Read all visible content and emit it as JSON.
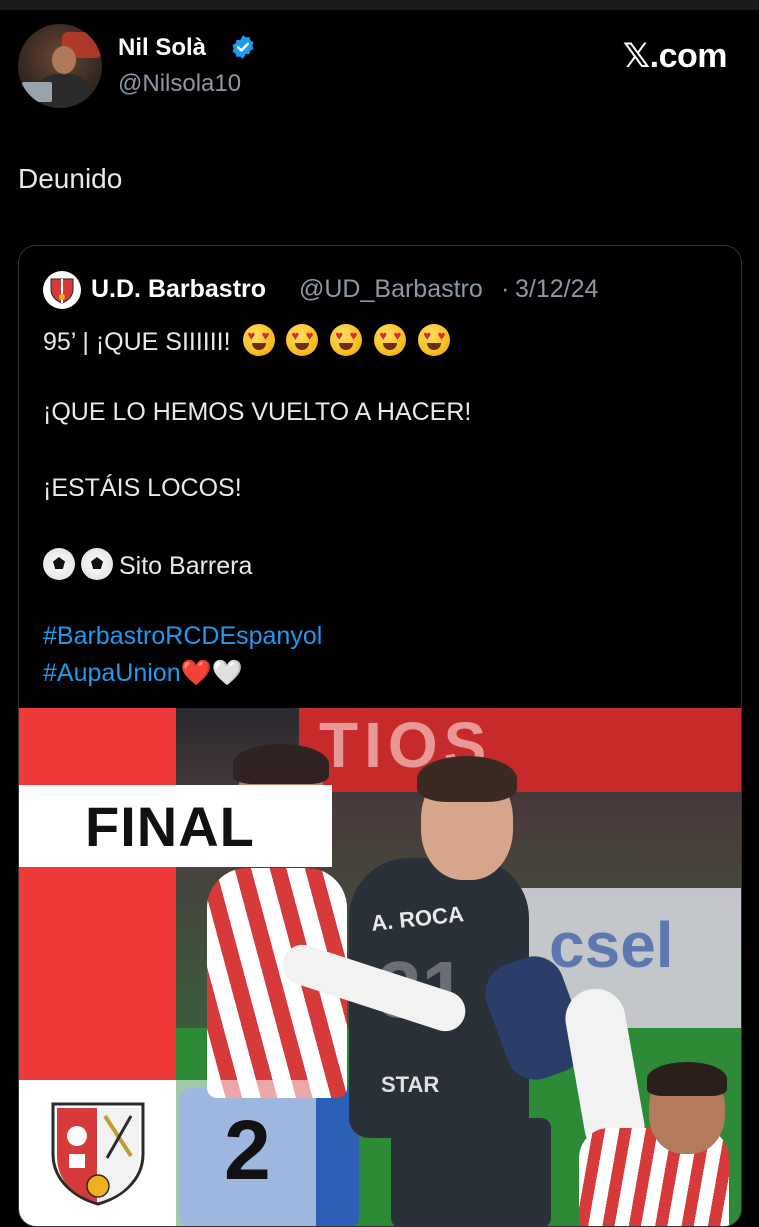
{
  "tweet": {
    "author_name": "Nil Solà",
    "author_handle": "@Nilsola10",
    "site": "𝕏.com",
    "text": "Deunido"
  },
  "quoted": {
    "author_name": "U.D. Barbastro",
    "author_handle": "@UD_Barbastro",
    "separator": "·",
    "date": "3/12/24",
    "line1": "95’ | ¡QUE SIIIIII!",
    "line2": "¡QUE LO HEMOS VUELTO A HACER!",
    "line3": "¡ESTÁIS LOCOS!",
    "line4": "Sito Barrera",
    "hashtag1": "#BarbastroRCDEspanyol",
    "hashtag2": "#AupaUnion",
    "red_heart": "❤️",
    "white_heart": "🤍"
  },
  "media": {
    "final_label": "FINAL",
    "score": "2",
    "banner_text": "TIOS",
    "ad_text": "csel",
    "player_name": "A. ROCA",
    "player_number": "31",
    "sponsor": "STAR"
  },
  "colors": {
    "background": "#000000",
    "link": "#1d9bf0",
    "verified": "#1d9bf0",
    "muted": "#8b98a5",
    "graphic_red": "#f03a3a"
  },
  "icons": {
    "verified": "verified-badge-icon",
    "heart_eyes": "smiling-face-with-heart-eyes-icon",
    "soccer_ball": "soccer-ball-icon"
  }
}
